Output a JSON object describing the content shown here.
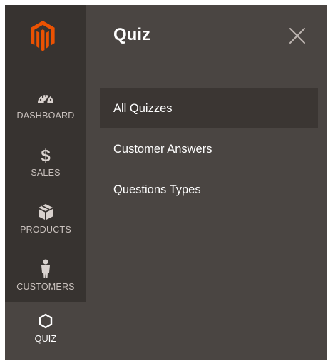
{
  "colors": {
    "sidebar_bg": "#373330",
    "panel_bg": "#4a4542",
    "active_item_bg": "#3b3633",
    "brand_orange": "#eb5202"
  },
  "sidebar": {
    "logo_icon": "magento-logo-icon",
    "items": [
      {
        "label": "DASHBOARD",
        "icon": "speedometer-icon",
        "active": false
      },
      {
        "label": "SALES",
        "icon": "dollar-icon",
        "active": false
      },
      {
        "label": "PRODUCTS",
        "icon": "box-icon",
        "active": false
      },
      {
        "label": "CUSTOMERS",
        "icon": "person-icon",
        "active": false
      },
      {
        "label": "QUIZ",
        "icon": "hexagon-icon",
        "active": true
      }
    ]
  },
  "panel": {
    "title": "Quiz",
    "close_icon": "close-icon",
    "menu": [
      {
        "label": "All Quizzes",
        "active": true
      },
      {
        "label": "Customer Answers",
        "active": false
      },
      {
        "label": "Questions Types",
        "active": false
      }
    ]
  }
}
